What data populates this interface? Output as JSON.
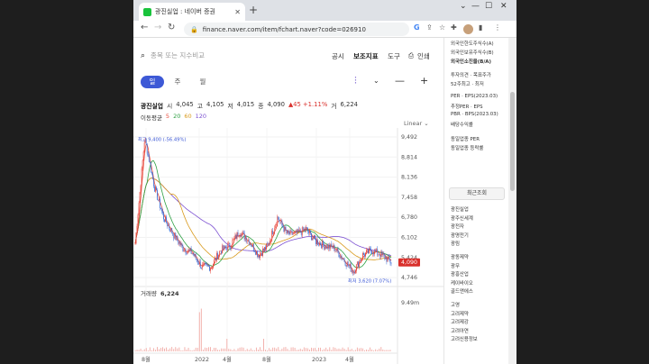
{
  "browser": {
    "tab_title": "광진실업 : 네이버 증권",
    "url": "finance.naver.com/item/fchart.naver?code=026910"
  },
  "header": {
    "search_placeholder": "종목 또는 지수비교",
    "menu": [
      "공시",
      "보조지표",
      "도구",
      "인쇄"
    ]
  },
  "periods": [
    "일",
    "주",
    "월"
  ],
  "quote": {
    "name": "광진실업",
    "open_label": "시",
    "open": "4,045",
    "high_label": "고",
    "high": "4,105",
    "low_label": "저",
    "low": "4,015",
    "close_label": "종",
    "close": "4,090",
    "change": "▲45 +1.11%",
    "volume_label": "거",
    "volume": "6,224"
  },
  "moving_avg": {
    "label": "이동평균",
    "periods": [
      {
        "value": "5",
        "color": "#e84b3c"
      },
      {
        "value": "20",
        "color": "#2ea043"
      },
      {
        "value": "60",
        "color": "#d99a1d"
      },
      {
        "value": "120",
        "color": "#7b4fd1"
      }
    ]
  },
  "chart_scale": "Linear",
  "chart_data": {
    "type": "line",
    "yticks": [
      "9,492",
      "8,814",
      "8,136",
      "7,458",
      "6,780",
      "6,102",
      "5,424",
      "4,746"
    ],
    "xticks": [
      "8월",
      "2022",
      "4월",
      "8월",
      "2023",
      "4월"
    ],
    "high_label": "최고 9,400 (-56.49%)",
    "low_label": "최저 3,620 (7.07%)",
    "current_label": "4,090",
    "volume_title": "거래량",
    "volume_value": "6,224",
    "volume_tick": "9.49m",
    "price_series": [
      [
        "2021-07",
        4.9
      ],
      [
        "2021-07",
        9.4
      ],
      [
        "2021-08",
        7.3
      ],
      [
        "2021-08",
        6.0
      ],
      [
        "2021-09",
        5.3
      ],
      [
        "2021-10",
        4.7
      ],
      [
        "2021-11",
        4.5
      ],
      [
        "2021-12",
        3.9
      ],
      [
        "2022-01",
        3.9
      ],
      [
        "2022-02",
        4.6
      ],
      [
        "2022-03",
        4.8
      ],
      [
        "2022-04",
        5.4
      ],
      [
        "2022-05",
        5.0
      ],
      [
        "2022-06",
        4.4
      ],
      [
        "2022-07",
        4.8
      ],
      [
        "2022-08",
        6.0
      ],
      [
        "2022-09",
        5.3
      ],
      [
        "2022-10",
        5.3
      ],
      [
        "2022-11",
        5.5
      ],
      [
        "2022-12",
        5.0
      ],
      [
        "2023-01",
        4.8
      ],
      [
        "2023-02",
        4.7
      ],
      [
        "2023-03",
        4.2
      ],
      [
        "2023-04",
        3.7
      ],
      [
        "2023-04",
        4.4
      ],
      [
        "2023-05",
        4.6
      ],
      [
        "2023-06",
        4.4
      ],
      [
        "2023-07",
        4.1
      ]
    ]
  },
  "sidebar": {
    "items_top": [
      "외국인한도주식수(A)",
      "외국인보유주식수(B)",
      "외국인소진율(B/A)",
      "투자의견 · 목표주가",
      "52주최고 · 최저",
      "PER · EPS(2023.03)",
      "추정PER · EPS",
      "PBR · BPS(2023.03)",
      "배당수익률",
      "동일업종 PER",
      "동일업종 등락률"
    ],
    "recent_title": "최근조회",
    "recent_items": [
      "광진실업",
      "광주신세계",
      "광전자",
      "광명전기",
      "광림",
      "광동제약",
      "광무",
      "광흥산업",
      "케이바이오",
      "골드앤에스",
      "고영",
      "고려제약",
      "고려제강",
      "고려아연",
      "고려신용정보"
    ]
  }
}
